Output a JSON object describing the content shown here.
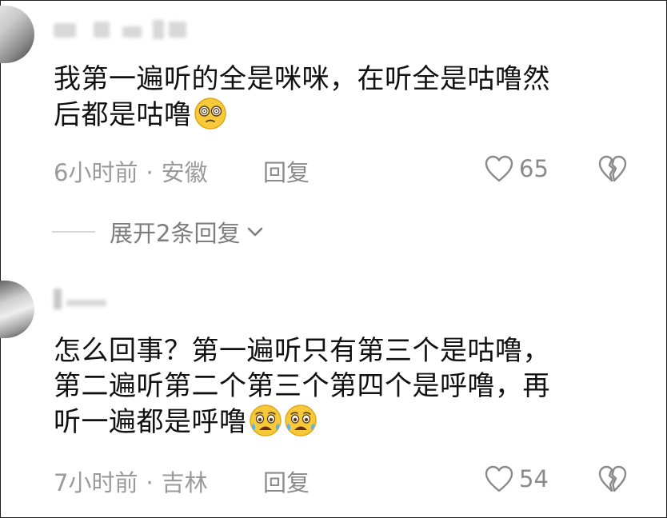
{
  "comments": [
    {
      "text_line1": "我第一遍听的全是咪咪，在听全是咕噜然",
      "text_line2": "后都是咕噜",
      "emoji": "dizzy-face-emoji",
      "time": "6小时前",
      "dot": "·",
      "location": "安徽",
      "reply_label": "回复",
      "likes": "65"
    },
    {
      "text_line1": "怎么回事？第一遍听只有第三个是咕噜，",
      "text_line2": "第二遍听第二个第三个第四个是呼噜，再",
      "text_line3": "听一遍都是呼噜",
      "emoji": "crying-face-emoji",
      "time": "7小时前",
      "dot": "·",
      "location": "吉林",
      "reply_label": "回复",
      "likes": "54"
    }
  ],
  "expand_replies": {
    "label": "展开2条回复"
  },
  "colors": {
    "text": "#111111",
    "meta": "#9a9a9a",
    "icon": "#8a8a8a"
  }
}
